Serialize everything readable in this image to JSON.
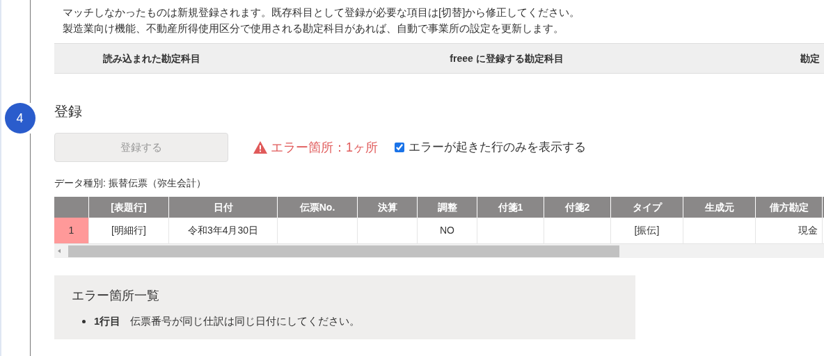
{
  "intro_lines": [
    "マッチしなかったものは新規登録されます。既存科目として登録が必要な項目は[切替]から修正してください。",
    "製造業向け機能、不動産所得使用区分で使用される勘定科目があれば、自動で事業所の設定を更新します。"
  ],
  "mapping_table": {
    "columns": [
      "読み込まれた勘定科目",
      "freee に登録する勘定科目",
      "勘定"
    ]
  },
  "step": {
    "number": "4",
    "title": "登録"
  },
  "register_button": {
    "label": "登録する",
    "disabled": true
  },
  "error_summary": "エラー箇所：1ヶ所",
  "error_filter": {
    "label": "エラーが起きた行のみを表示する",
    "checked": true
  },
  "data_type": "データ種別: 振替伝票（弥生会計）",
  "preview_table": {
    "columns": [
      "",
      "[表題行]",
      "日付",
      "伝票No.",
      "決算",
      "調整",
      "付箋1",
      "付箋2",
      "タイプ",
      "生成元",
      "借方勘定"
    ],
    "rows": [
      {
        "has_error": true,
        "cells": [
          "1",
          "[明細行]",
          "令和3年4月30日",
          "",
          "",
          "NO",
          "",
          "",
          "[振伝]",
          "",
          "現金"
        ]
      }
    ]
  },
  "error_list": {
    "title": "エラー箇所一覧",
    "items": [
      {
        "row": "1行目",
        "message": "伝票番号が同じ仕訳は同じ日付にしてください。"
      }
    ]
  }
}
